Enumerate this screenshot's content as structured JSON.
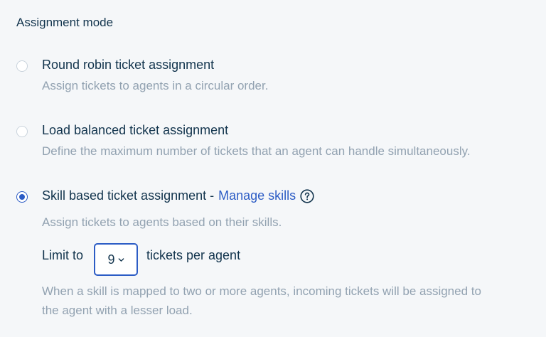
{
  "section_title": "Assignment mode",
  "options": [
    {
      "label": "Round robin ticket assignment",
      "description": "Assign tickets to agents in a circular order.",
      "selected": false
    },
    {
      "label": "Load balanced ticket assignment",
      "description": "Define the maximum number of tickets that an agent can handle simultaneously.",
      "selected": false
    },
    {
      "label": "Skill based ticket assignment -",
      "link": "Manage skills",
      "description": "Assign tickets to agents based on their skills.",
      "selected": true
    }
  ],
  "limit": {
    "prefix": "Limit to",
    "value": "9",
    "suffix": "tickets per agent"
  },
  "note_line1": "When a skill is mapped to two or more agents, incoming tickets will be assigned to",
  "note_line2": "the agent with a lesser load.",
  "colors": {
    "accent": "#2c5cc5",
    "text": "#12344d",
    "muted": "#92a2b1",
    "background": "#f5f7f9"
  },
  "icons": [
    "help-circle-icon",
    "chevron-down-icon"
  ]
}
